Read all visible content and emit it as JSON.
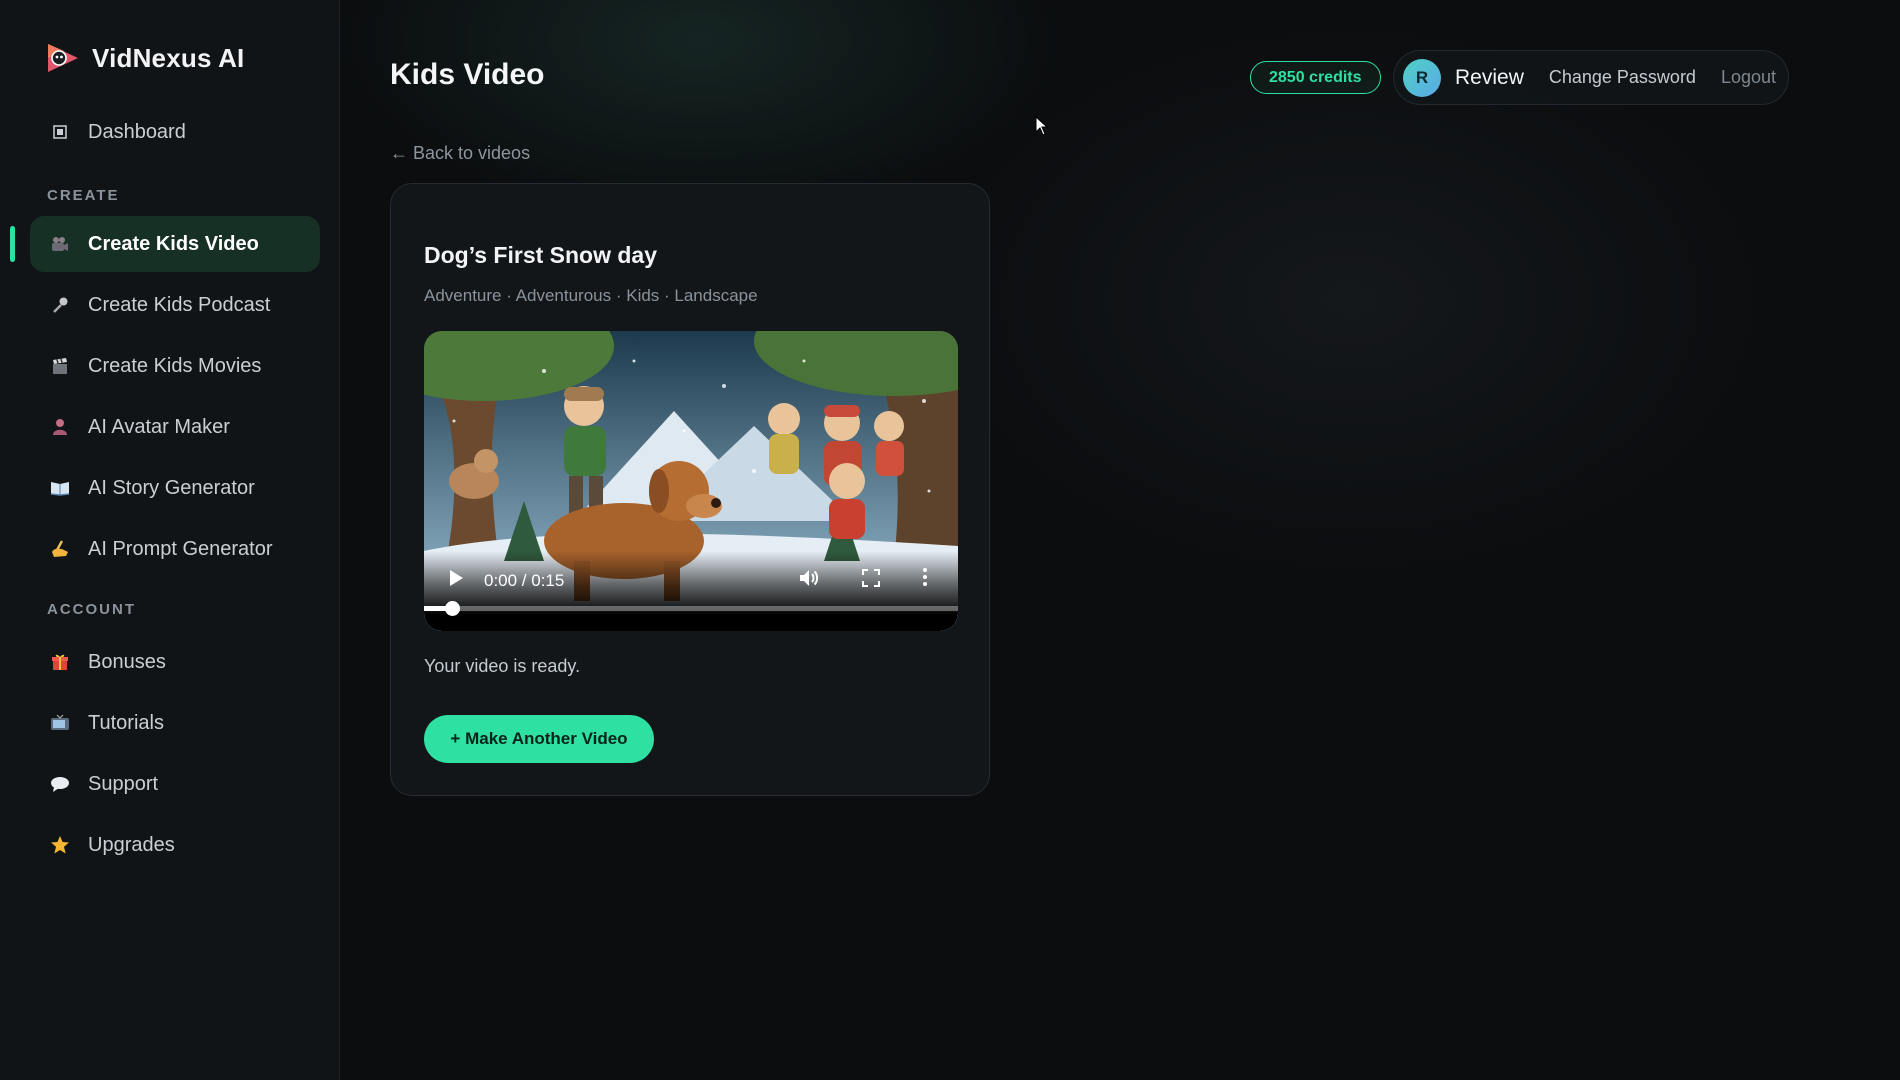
{
  "brand": {
    "name": "VidNexus AI"
  },
  "sidebar": {
    "dashboard": {
      "label": "Dashboard",
      "icon": "dashboard-icon"
    },
    "create_section": "CREATE",
    "create_items": [
      {
        "label": "Create Kids Video",
        "icon": "camera-icon",
        "active": true
      },
      {
        "label": "Create Kids Podcast",
        "icon": "microphone-icon"
      },
      {
        "label": "Create Kids Movies",
        "icon": "clapper-icon"
      },
      {
        "label": "AI Avatar Maker",
        "icon": "person-icon"
      },
      {
        "label": "AI Story Generator",
        "icon": "book-icon"
      },
      {
        "label": "AI Prompt Generator",
        "icon": "writing-hand-icon"
      }
    ],
    "account_section": "ACCOUNT",
    "account_items": [
      {
        "label": "Bonuses",
        "icon": "gift-icon"
      },
      {
        "label": "Tutorials",
        "icon": "tv-icon"
      },
      {
        "label": "Support",
        "icon": "speech-bubble-icon"
      },
      {
        "label": "Upgrades",
        "icon": "star-icon"
      }
    ]
  },
  "header": {
    "title": "Kids Video",
    "credits": "2850 credits",
    "user": {
      "initial": "R",
      "name": "Review"
    },
    "change_password": "Change Password",
    "logout": "Logout"
  },
  "back_link": "← Back to videos",
  "card": {
    "title": "Dog’s First Snow day",
    "tags": "Adventure · Adventurous · Kids · Landscape",
    "video": {
      "time": "0:00 / 0:15",
      "progress": 0
    },
    "status": "Your video is ready.",
    "action_label": "+ Make Another Video"
  },
  "colors": {
    "accent": "#2ee0a1",
    "background": "#0b0d0f",
    "sidebar": "#111416",
    "card": "#121619"
  }
}
